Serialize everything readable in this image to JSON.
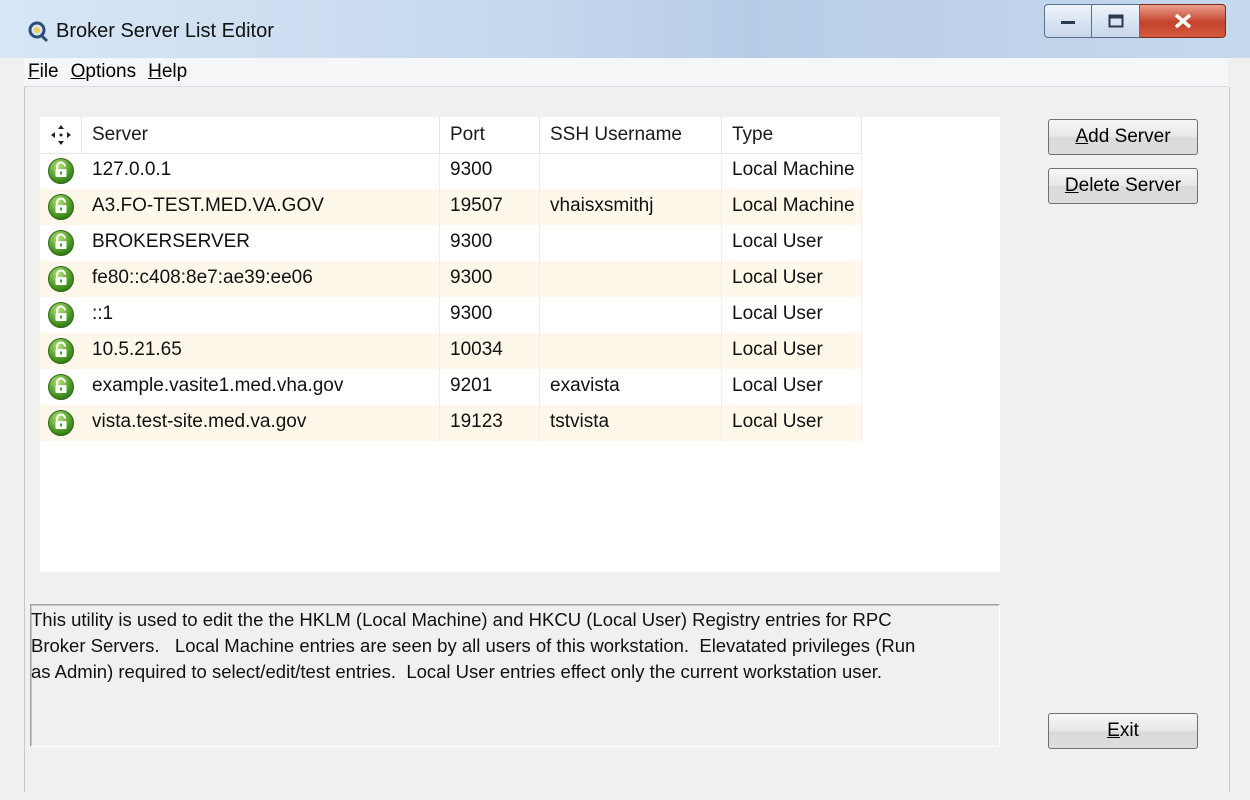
{
  "window": {
    "title": "Broker Server List Editor",
    "controls": [
      "minimize",
      "maximize",
      "close"
    ]
  },
  "menu": [
    {
      "label": "File",
      "mnemonic": "F",
      "rest": "ile"
    },
    {
      "label": "Options",
      "mnemonic": "O",
      "rest": "ptions"
    },
    {
      "label": "Help",
      "mnemonic": "H",
      "rest": "elp"
    }
  ],
  "listview": {
    "header_icon": "move-arrows-icon",
    "columns": [
      "Server",
      "Port",
      "SSH Username",
      "Type"
    ],
    "rows": [
      {
        "server": "127.0.0.1",
        "port": "9300",
        "ssh": "",
        "type": "Local Machine"
      },
      {
        "server": "A3.FO-TEST.MED.VA.GOV",
        "port": "19507",
        "ssh": "vhaisxsmithj",
        "type": "Local Machine"
      },
      {
        "server": "BROKERSERVER",
        "port": "9300",
        "ssh": "",
        "type": "Local User"
      },
      {
        "server": "fe80::c408:8e7:ae39:ee06",
        "port": "9300",
        "ssh": "",
        "type": "Local User"
      },
      {
        "server": "::1",
        "port": "9300",
        "ssh": "",
        "type": "Local User"
      },
      {
        "server": "10.5.21.65",
        "port": "10034",
        "ssh": "",
        "type": "Local User"
      },
      {
        "server": "example.vasite1.med.vha.gov",
        "port": "9201",
        "ssh": "exavista",
        "type": "Local User"
      },
      {
        "server": "vista.test-site.med.va.gov",
        "port": "19123",
        "ssh": "tstvista",
        "type": "Local User"
      }
    ],
    "row_icon": "green-unlocked-padlock-icon"
  },
  "buttons": {
    "add": {
      "label": "Add Server",
      "mnemonic": "A",
      "rest": "dd Server"
    },
    "delete": {
      "label": "Delete Server",
      "mnemonic": "D",
      "rest": "elete Server"
    },
    "exit": {
      "label": "Exit",
      "mnemonic": "E",
      "rest": "xit"
    }
  },
  "description": {
    "line1": "This utility is used to edit the the HKLM (Local Machine) and HKCU (Local User) Registry entries for RPC",
    "line2": "Broker Servers.   Local Machine entries are seen by all users of this workstation.  Elevatated privileges (Run",
    "line3": "as Admin) required to select/edit/test entries.  Local User entries effect only the current workstation user."
  },
  "colors": {
    "row_alt": "#fdf8ea",
    "lock_green": "#4a9a2a"
  }
}
